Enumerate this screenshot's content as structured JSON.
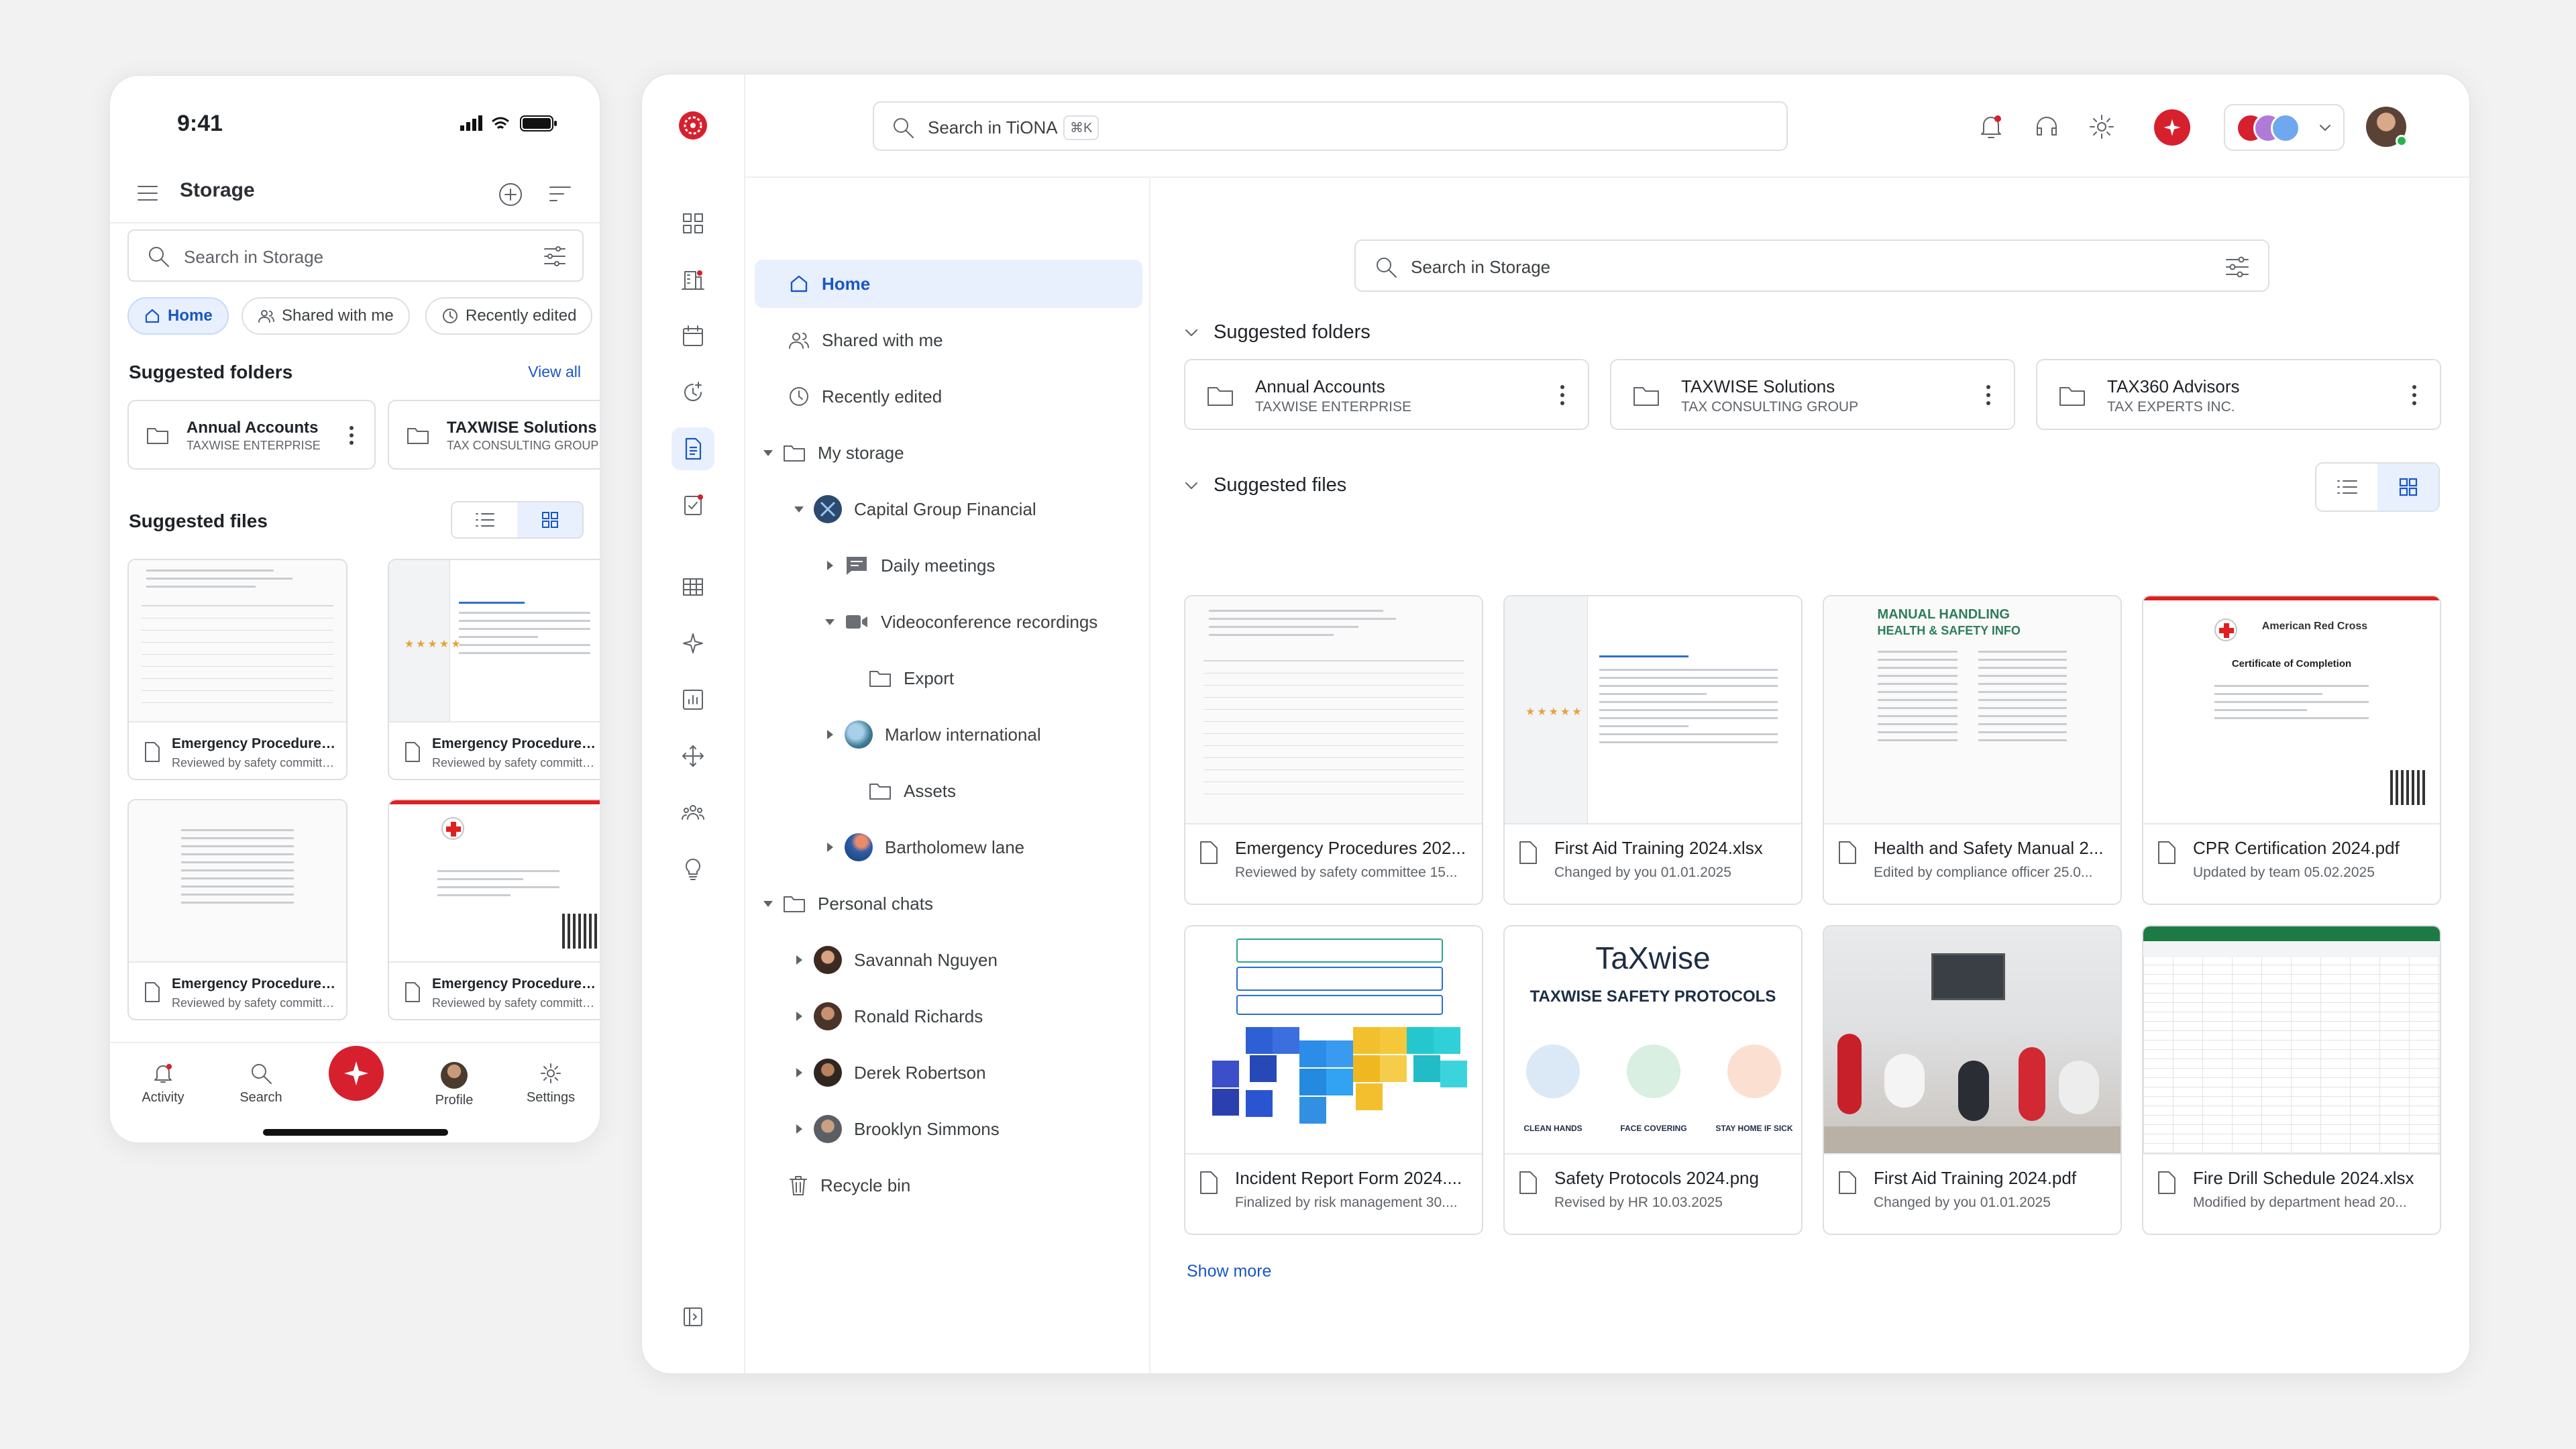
{
  "phone": {
    "time": "9:41",
    "title": "Storage",
    "search_placeholder": "Search in Storage",
    "chips": [
      "Home",
      "Shared with me",
      "Recently edited"
    ],
    "suggested_folders_heading": "Suggested folders",
    "view_all": "View all",
    "folders": [
      {
        "name": "Annual Accounts",
        "sub": "TAXWISE ENTERPRISE"
      },
      {
        "name": "TAXWISE Solutions",
        "sub": "TAX CONSULTING GROUP"
      }
    ],
    "suggested_files_heading": "Suggested files",
    "files": [
      {
        "name": "Emergency Procedures...",
        "sub": "Reviewed by safety committee..."
      },
      {
        "name": "Emergency Procedures...",
        "sub": "Reviewed by safety committee..."
      },
      {
        "name": "Emergency Procedures...",
        "sub": "Reviewed by safety committee..."
      },
      {
        "name": "Emergency Procedures...",
        "sub": "Reviewed by safety committee..."
      }
    ],
    "tabs": [
      "Activity",
      "Search",
      "Profile",
      "Settings"
    ]
  },
  "desktop": {
    "search_placeholder": "Search in TiONA",
    "search_shortcut": "⌘K",
    "nav": {
      "home": "Home",
      "shared": "Shared with me",
      "recent": "Recently edited",
      "my_storage": "My storage",
      "capital": "Capital Group Financial",
      "daily": "Daily meetings",
      "video": "Videoconference recordings",
      "export": "Export",
      "marlow": "Marlow international",
      "assets": "Assets",
      "bartholomew": "Bartholomew lane",
      "personal": "Personal chats",
      "savannah": "Savannah Nguyen",
      "ronald": "Ronald Richards",
      "derek": "Derek Robertson",
      "brooklyn": "Brooklyn Simmons",
      "recycle": "Recycle bin"
    },
    "main_search_placeholder": "Search in Storage",
    "suggested_folders_heading": "Suggested folders",
    "folders": [
      {
        "name": "Annual Accounts",
        "sub": "TAXWISE ENTERPRISE"
      },
      {
        "name": "TAXWISE Solutions",
        "sub": "TAX CONSULTING GROUP"
      },
      {
        "name": "TAX360 Advisors",
        "sub": "TAX EXPERTS INC."
      }
    ],
    "suggested_files_heading": "Suggested files",
    "files": [
      {
        "name": "Emergency Procedures 202...",
        "sub": "Reviewed by safety committee 15..."
      },
      {
        "name": "First Aid Training 2024.xlsx",
        "sub": "Changed by you 01.01.2025"
      },
      {
        "name": "Health and Safety Manual 2...",
        "sub": "Edited by compliance officer 25.0..."
      },
      {
        "name": "CPR Certification 2024.pdf",
        "sub": "Updated by team 05.02.2025"
      },
      {
        "name": "Incident Report Form 2024....",
        "sub": "Finalized by risk management 30...."
      },
      {
        "name": "Safety Protocols 2024.png",
        "sub": "Revised by HR 10.03.2025"
      },
      {
        "name": "First Aid Training 2024.pdf",
        "sub": "Changed by you 01.01.2025"
      },
      {
        "name": "Fire Drill Schedule 2024.xlsx",
        "sub": "Modified by department head 20..."
      }
    ],
    "show_more": "Show more"
  },
  "thumbnails": {
    "manual_title": "MANUAL HANDLING",
    "manual_subtitle": "HEALTH & SAFETY INFO",
    "cert_org": "American Red Cross",
    "cert_title": "Certificate of Completion",
    "tax_logo": "TaXwise",
    "tax_title": "TAXWISE SAFETY PROTOCOLS",
    "tax_items": [
      "CLEAN HANDS",
      "FACE COVERING",
      "STAY HOME IF SICK"
    ]
  },
  "colors": {
    "accent": "#1a56c4",
    "brand_red": "#d6202e",
    "selected_bg": "#e8f0fe"
  }
}
